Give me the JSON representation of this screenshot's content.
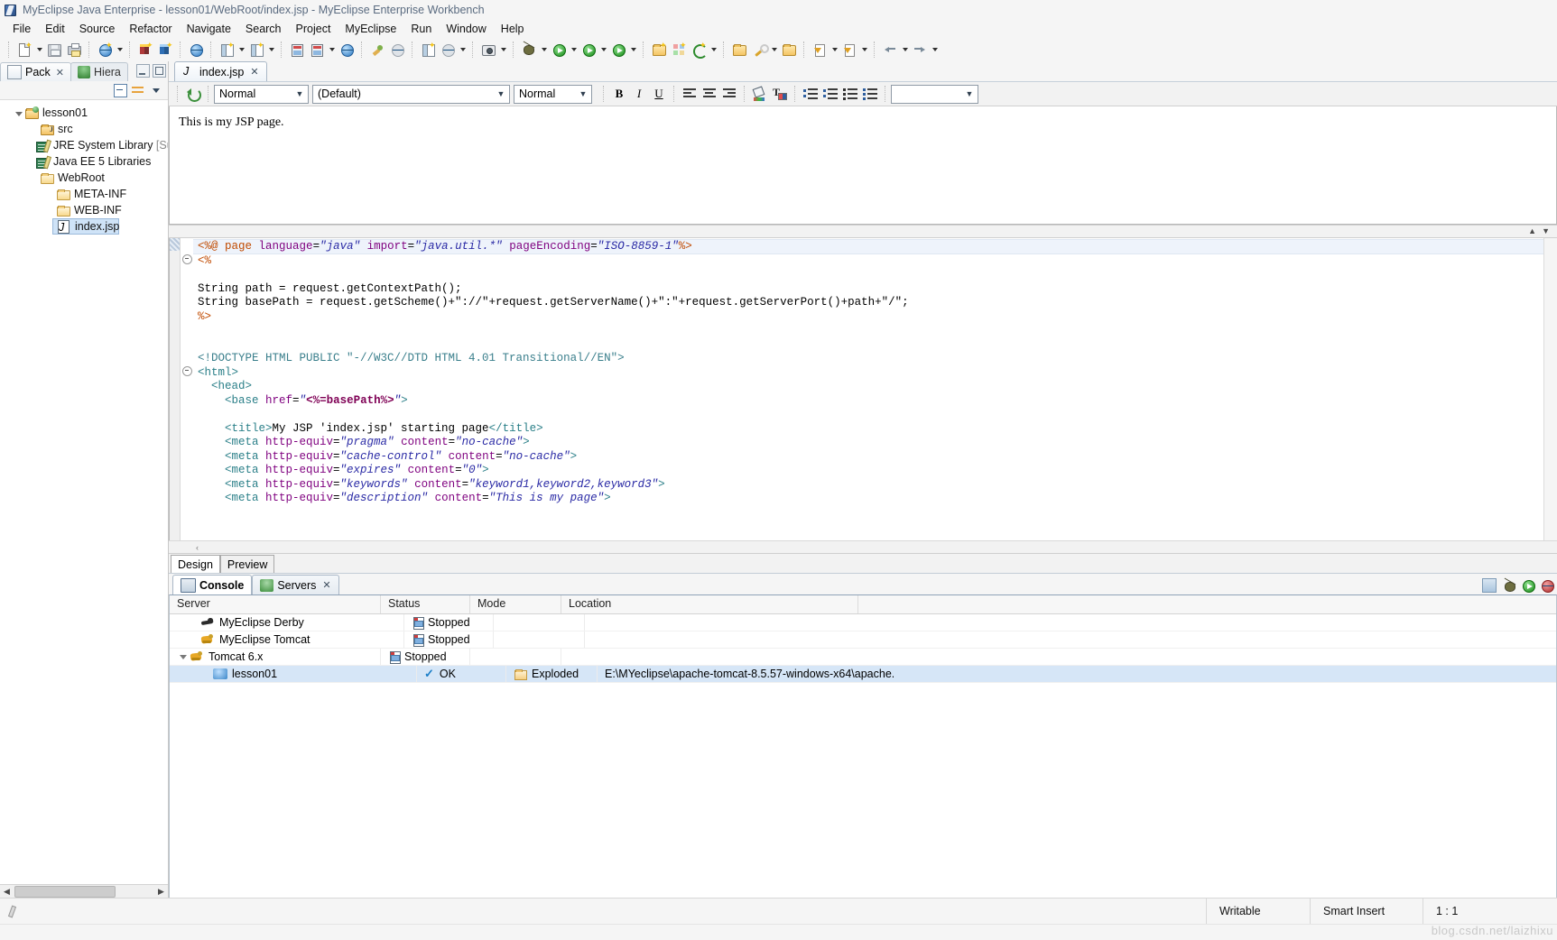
{
  "window": {
    "title": "MyEclipse Java Enterprise - lesson01/WebRoot/index.jsp - MyEclipse Enterprise Workbench",
    "app_icon": "myeclipse-icon"
  },
  "menubar": {
    "items": [
      "File",
      "Edit",
      "Source",
      "Refactor",
      "Navigate",
      "Search",
      "Project",
      "MyEclipse",
      "Run",
      "Window",
      "Help"
    ]
  },
  "toolbar": {
    "groups": [
      {
        "buttons": [
          {
            "name": "new-wizard",
            "icon": "new-file-icon",
            "arrow": true
          },
          {
            "name": "save",
            "icon": "save-icon",
            "arrow": false
          },
          {
            "name": "print",
            "icon": "print-icon",
            "arrow": false
          }
        ]
      },
      {
        "buttons": [
          {
            "name": "new-deployment",
            "icon": "deploy-icon",
            "arrow": true
          }
        ]
      },
      {
        "buttons": [
          {
            "name": "db-browser-red",
            "icon": "cube-red-icon",
            "arrow": false
          },
          {
            "name": "db-browser-blue",
            "icon": "cube-blue-icon",
            "arrow": false
          }
        ]
      },
      {
        "buttons": [
          {
            "name": "web20-tools",
            "icon": "web20-icon",
            "arrow": false
          }
        ]
      },
      {
        "buttons": [
          {
            "name": "new-java-project",
            "icon": "java-new-icon",
            "arrow": true
          },
          {
            "name": "new-web-project",
            "icon": "web-new-icon",
            "arrow": true
          }
        ]
      },
      {
        "buttons": [
          {
            "name": "server-deploy",
            "icon": "server-deploy-icon",
            "arrow": false
          },
          {
            "name": "run-server",
            "icon": "server-run-icon",
            "arrow": true
          },
          {
            "name": "open-browser",
            "icon": "globe-icon",
            "arrow": false
          }
        ]
      },
      {
        "buttons": [
          {
            "name": "validate",
            "icon": "validate-icon",
            "arrow": false
          },
          {
            "name": "refresh-project",
            "icon": "refresh-project-icon",
            "arrow": false
          }
        ]
      },
      {
        "buttons": [
          {
            "name": "report-designer",
            "icon": "report-icon",
            "arrow": false
          },
          {
            "name": "snapshot",
            "icon": "snapshot-icon",
            "arrow": true
          }
        ]
      },
      {
        "buttons": [
          {
            "name": "screenshot",
            "icon": "camera-icon",
            "arrow": true
          }
        ]
      },
      {
        "buttons": [
          {
            "name": "debug",
            "icon": "debug-icon",
            "arrow": true
          },
          {
            "name": "run",
            "icon": "run-icon",
            "arrow": true
          },
          {
            "name": "run-configurations",
            "icon": "run-config-icon",
            "arrow": true
          },
          {
            "name": "run-external-tools",
            "icon": "external-tools-icon",
            "arrow": true
          }
        ]
      },
      {
        "buttons": [
          {
            "name": "new-folder",
            "icon": "folder-new-icon",
            "arrow": false
          },
          {
            "name": "new-grid",
            "icon": "grid-new-icon",
            "arrow": false
          },
          {
            "name": "new-google",
            "icon": "google-new-icon",
            "arrow": true
          }
        ]
      },
      {
        "buttons": [
          {
            "name": "open-type",
            "icon": "open-type-icon",
            "arrow": false
          },
          {
            "name": "search-tool",
            "icon": "search-tool-icon",
            "arrow": true
          },
          {
            "name": "open-resource",
            "icon": "open-resource-icon",
            "arrow": false
          }
        ]
      },
      {
        "buttons": [
          {
            "name": "next-annotation",
            "icon": "next-annotation-icon",
            "arrow": true
          },
          {
            "name": "previous-annotation",
            "icon": "previous-annotation-icon",
            "arrow": true
          }
        ]
      },
      {
        "buttons": [
          {
            "name": "back",
            "icon": "back-arrow-icon",
            "arrow": true
          },
          {
            "name": "forward",
            "icon": "forward-arrow-icon",
            "arrow": true
          }
        ]
      }
    ]
  },
  "left_view": {
    "tabs": [
      {
        "label": "Pack",
        "icon": "package-explorer-icon",
        "active": true,
        "closeable": true
      },
      {
        "label": "Hiera",
        "icon": "hierarchy-icon",
        "active": false,
        "closeable": false
      }
    ],
    "view_buttons": [
      "collapse-all-icon",
      "link-with-editor-icon",
      "view-menu-icon"
    ],
    "tree": [
      {
        "label": "lesson01",
        "icon": "project-icon",
        "indent": 0,
        "twisty": "open",
        "selected": false
      },
      {
        "label": "src",
        "icon": "source-folder-icon",
        "indent": 1,
        "twisty": "none",
        "selected": false
      },
      {
        "label": "JRE System Library ",
        "suffix": "[Su",
        "icon": "library-icon",
        "indent": 1,
        "twisty": "none",
        "selected": false
      },
      {
        "label": "Java EE 5 Libraries",
        "icon": "library-icon",
        "indent": 1,
        "twisty": "none",
        "selected": false
      },
      {
        "label": "WebRoot",
        "icon": "folder-icon",
        "indent": 1,
        "twisty": "open",
        "selected": false
      },
      {
        "label": "META-INF",
        "icon": "folder-icon",
        "indent": 2,
        "twisty": "none",
        "selected": false
      },
      {
        "label": "WEB-INF",
        "icon": "folder-icon",
        "indent": 2,
        "twisty": "none",
        "selected": false
      },
      {
        "label": "index.jsp",
        "icon": "jsp-file-icon",
        "indent": 2,
        "twisty": "none",
        "selected": true
      }
    ]
  },
  "editor": {
    "tabs": [
      {
        "label": "index.jsp",
        "icon": "jsp-file-icon",
        "closeable": true
      }
    ],
    "format_toolbar": {
      "refresh": "refresh-icon",
      "style_combo": "Normal",
      "font_combo": "(Default)",
      "size_combo": "Normal",
      "bold": "B",
      "italic": "I",
      "underline": "U",
      "align_left": "align-left-icon",
      "align_center": "align-center-icon",
      "align_right": "align-right-icon",
      "fill_color": "fill-color-icon",
      "text_color": "text-color-icon",
      "outdent": "outdent-icon",
      "indent": "indent-icon",
      "ordered_list": "ordered-list-icon",
      "unordered_list": "unordered-list-icon",
      "extra_combo": ""
    },
    "design_text": "This is my JSP page.",
    "bottom_tabs": [
      {
        "label": "Design",
        "active": true
      },
      {
        "label": "Preview",
        "active": false
      }
    ],
    "source_lines": [
      {
        "highlight": true,
        "fold": false,
        "tokens": [
          {
            "t": "<%@ ",
            "c": "k-dir"
          },
          {
            "t": "page",
            "c": "k-dir"
          },
          {
            "t": " ",
            "c": "k-txt"
          },
          {
            "t": "language",
            "c": "k-attr"
          },
          {
            "t": "=",
            "c": "k-punc"
          },
          {
            "t": "\"java\"",
            "c": "k-val"
          },
          {
            "t": " ",
            "c": "k-txt"
          },
          {
            "t": "import",
            "c": "k-attr"
          },
          {
            "t": "=",
            "c": "k-punc"
          },
          {
            "t": "\"java.util.*\"",
            "c": "k-val"
          },
          {
            "t": " ",
            "c": "k-txt"
          },
          {
            "t": "pageEncoding",
            "c": "k-attr"
          },
          {
            "t": "=",
            "c": "k-punc"
          },
          {
            "t": "\"ISO-8859-1\"",
            "c": "k-val"
          },
          {
            "t": "%>",
            "c": "k-dir"
          }
        ]
      },
      {
        "highlight": false,
        "fold": true,
        "tokens": [
          {
            "t": "<%",
            "c": "k-dir"
          }
        ]
      },
      {
        "highlight": false,
        "fold": false,
        "tokens": []
      },
      {
        "highlight": false,
        "fold": false,
        "tokens": [
          {
            "t": "String path = request.getContextPath();",
            "c": "k-txt"
          }
        ]
      },
      {
        "highlight": false,
        "fold": false,
        "tokens": [
          {
            "t": "String basePath = request.getScheme()+\"://\"+request.getServerName()+\":\"+request.getServerPort()+path+\"/\";",
            "c": "k-txt"
          }
        ]
      },
      {
        "highlight": false,
        "fold": false,
        "tokens": [
          {
            "t": "%>",
            "c": "k-dir"
          }
        ]
      },
      {
        "highlight": false,
        "fold": false,
        "tokens": []
      },
      {
        "highlight": false,
        "fold": false,
        "tokens": []
      },
      {
        "highlight": false,
        "fold": false,
        "tokens": [
          {
            "t": "<!DOCTYPE HTML PUBLIC \"-//W3C//DTD HTML 4.01 Transitional//EN\">",
            "c": "k-doct"
          }
        ]
      },
      {
        "highlight": false,
        "fold": false,
        "tokens": [
          {
            "t": "<html>",
            "c": "k-tag"
          }
        ]
      },
      {
        "highlight": false,
        "fold": true,
        "indent": 2,
        "tokens": [
          {
            "t": "  <head>",
            "c": "k-tag"
          }
        ]
      },
      {
        "highlight": false,
        "fold": false,
        "tokens": [
          {
            "t": "    <base ",
            "c": "k-tag"
          },
          {
            "t": "href",
            "c": "k-attr"
          },
          {
            "t": "=",
            "c": "k-punc"
          },
          {
            "t": "\"",
            "c": "k-val"
          },
          {
            "t": "<%=basePath%>",
            "c": "k-jsp"
          },
          {
            "t": "\"",
            "c": "k-val"
          },
          {
            "t": ">",
            "c": "k-tag"
          }
        ]
      },
      {
        "highlight": false,
        "fold": false,
        "tokens": []
      },
      {
        "highlight": false,
        "fold": false,
        "tokens": [
          {
            "t": "    <title>",
            "c": "k-tag"
          },
          {
            "t": "My JSP 'index.jsp' starting page",
            "c": "k-txt"
          },
          {
            "t": "</title>",
            "c": "k-tag"
          }
        ]
      },
      {
        "highlight": false,
        "fold": false,
        "tokens": [
          {
            "t": "    <meta ",
            "c": "k-tag"
          },
          {
            "t": "http-equiv",
            "c": "k-attr"
          },
          {
            "t": "=",
            "c": "k-punc"
          },
          {
            "t": "\"pragma\"",
            "c": "k-val"
          },
          {
            "t": " ",
            "c": "k-txt"
          },
          {
            "t": "content",
            "c": "k-attr"
          },
          {
            "t": "=",
            "c": "k-punc"
          },
          {
            "t": "\"no-cache\"",
            "c": "k-val"
          },
          {
            "t": ">",
            "c": "k-tag"
          }
        ]
      },
      {
        "highlight": false,
        "fold": false,
        "tokens": [
          {
            "t": "    <meta ",
            "c": "k-tag"
          },
          {
            "t": "http-equiv",
            "c": "k-attr"
          },
          {
            "t": "=",
            "c": "k-punc"
          },
          {
            "t": "\"cache-control\"",
            "c": "k-val"
          },
          {
            "t": " ",
            "c": "k-txt"
          },
          {
            "t": "content",
            "c": "k-attr"
          },
          {
            "t": "=",
            "c": "k-punc"
          },
          {
            "t": "\"no-cache\"",
            "c": "k-val"
          },
          {
            "t": ">",
            "c": "k-tag"
          }
        ]
      },
      {
        "highlight": false,
        "fold": false,
        "tokens": [
          {
            "t": "    <meta ",
            "c": "k-tag"
          },
          {
            "t": "http-equiv",
            "c": "k-attr"
          },
          {
            "t": "=",
            "c": "k-punc"
          },
          {
            "t": "\"expires\"",
            "c": "k-val"
          },
          {
            "t": " ",
            "c": "k-txt"
          },
          {
            "t": "content",
            "c": "k-attr"
          },
          {
            "t": "=",
            "c": "k-punc"
          },
          {
            "t": "\"0\"",
            "c": "k-val"
          },
          {
            "t": ">",
            "c": "k-tag"
          }
        ]
      },
      {
        "highlight": false,
        "fold": false,
        "tokens": [
          {
            "t": "    <meta ",
            "c": "k-tag"
          },
          {
            "t": "http-equiv",
            "c": "k-attr"
          },
          {
            "t": "=",
            "c": "k-punc"
          },
          {
            "t": "\"keywords\"",
            "c": "k-val"
          },
          {
            "t": " ",
            "c": "k-txt"
          },
          {
            "t": "content",
            "c": "k-attr"
          },
          {
            "t": "=",
            "c": "k-punc"
          },
          {
            "t": "\"keyword1,keyword2,keyword3\"",
            "c": "k-val"
          },
          {
            "t": ">",
            "c": "k-tag"
          }
        ]
      },
      {
        "highlight": false,
        "fold": false,
        "tokens": [
          {
            "t": "    <meta ",
            "c": "k-tag"
          },
          {
            "t": "http-equiv",
            "c": "k-attr"
          },
          {
            "t": "=",
            "c": "k-punc"
          },
          {
            "t": "\"description\"",
            "c": "k-val"
          },
          {
            "t": " ",
            "c": "k-txt"
          },
          {
            "t": "content",
            "c": "k-attr"
          },
          {
            "t": "=",
            "c": "k-punc"
          },
          {
            "t": "\"This is my page\"",
            "c": "k-val"
          },
          {
            "t": ">",
            "c": "k-tag"
          }
        ]
      }
    ]
  },
  "bottom_panel": {
    "tabs": [
      {
        "label": "Console",
        "icon": "console-icon",
        "active": true,
        "bold": true,
        "closeable": false
      },
      {
        "label": "Servers",
        "icon": "servers-icon",
        "active": false,
        "bold": false,
        "closeable": true
      }
    ],
    "tab_buttons": [
      "pin-icon",
      "debug-server-icon",
      "start-server-icon",
      "stop-server-icon"
    ],
    "table": {
      "columns": [
        "Server",
        "Status",
        "Mode",
        "Location"
      ],
      "rows": [
        {
          "server": "MyEclipse Derby",
          "server_icon": "derby-icon",
          "status": "Stopped",
          "status_icon": "stopped-icon",
          "mode": "",
          "location": "",
          "indent": 1,
          "twisty": false,
          "selected": false
        },
        {
          "server": "MyEclipse Tomcat",
          "server_icon": "tomcat-icon",
          "status": "Stopped",
          "status_icon": "stopped-icon",
          "mode": "",
          "location": "",
          "indent": 1,
          "twisty": false,
          "selected": false
        },
        {
          "server": "Tomcat  6.x",
          "server_icon": "tomcat-icon",
          "status": "Stopped",
          "status_icon": "stopped-icon",
          "mode": "",
          "location": "",
          "indent": 0,
          "twisty": true,
          "selected": false
        },
        {
          "server": "lesson01",
          "server_icon": "module-icon",
          "status": "OK",
          "status_icon": "ok-check-icon",
          "mode": "Exploded",
          "mode_icon": "exploded-folder-icon",
          "location": "E:\\MYeclipse\\apache-tomcat-8.5.57-windows-x64\\apache...",
          "indent": 2,
          "twisty": false,
          "selected": true
        }
      ]
    }
  },
  "status_bar": {
    "left_icon": "edit-pencil-icon",
    "writable": "Writable",
    "insert_mode": "Smart Insert",
    "position": "1 : 1",
    "watermark": "blog.csdn.net/laizhixu"
  }
}
